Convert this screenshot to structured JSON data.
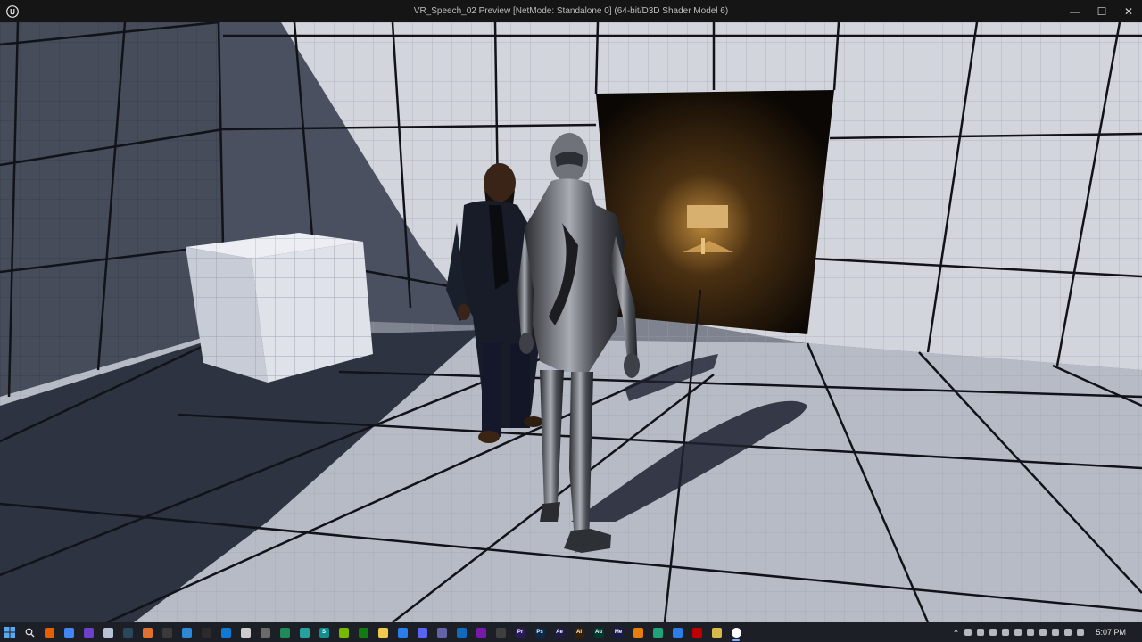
{
  "window": {
    "title": "VR_Speech_02 Preview [NetMode: Standalone 0]  (64-bit/D3D Shader Model 6)",
    "app_logo": "unreal-engine-icon",
    "controls": {
      "minimize": "—",
      "maximize": "☐",
      "close": "✕"
    }
  },
  "taskbar": {
    "start_icon": "windows-start-icon",
    "apps": [
      {
        "name": "search-icon",
        "label": "",
        "color": "#1c1f26"
      },
      {
        "name": "firefox-icon",
        "label": "",
        "color": "#e66000"
      },
      {
        "name": "chrome-icon",
        "label": "",
        "color": "#4285f4"
      },
      {
        "name": "github-desktop-icon",
        "label": "",
        "color": "#6e40c9"
      },
      {
        "name": "cloud-app-icon",
        "label": "",
        "color": "#b9c3d6"
      },
      {
        "name": "steam-icon",
        "label": "",
        "color": "#2a475e"
      },
      {
        "name": "puzzle-app-icon",
        "label": "",
        "color": "#e2712f"
      },
      {
        "name": "epic-games-icon",
        "label": "",
        "color": "#3a3a3a"
      },
      {
        "name": "monitor-app-icon",
        "label": "",
        "color": "#2e88d8"
      },
      {
        "name": "terminal-icon",
        "label": "",
        "color": "#2b2b2b"
      },
      {
        "name": "vscode-icon",
        "label": "",
        "color": "#0e7ad4"
      },
      {
        "name": "unity-icon",
        "label": "",
        "color": "#cccccc"
      },
      {
        "name": "audio-app-icon",
        "label": "",
        "color": "#6a6a6a"
      },
      {
        "name": "vpn-app-icon",
        "label": "",
        "color": "#1e8a5a"
      },
      {
        "name": "cube-app-icon",
        "label": "",
        "color": "#27a0a0"
      },
      {
        "name": "app-s-icon",
        "label": "S",
        "color": "#0f8f8f"
      },
      {
        "name": "nvidia-icon",
        "label": "",
        "color": "#76b900"
      },
      {
        "name": "xbox-icon",
        "label": "",
        "color": "#107c10"
      },
      {
        "name": "file-explorer-icon",
        "label": "",
        "color": "#f2c94c"
      },
      {
        "name": "photos-icon",
        "label": "",
        "color": "#2b7de9"
      },
      {
        "name": "discord-icon",
        "label": "",
        "color": "#5865f2"
      },
      {
        "name": "teams-icon",
        "label": "",
        "color": "#6264a7"
      },
      {
        "name": "outlook-icon",
        "label": "",
        "color": "#0f6cbd"
      },
      {
        "name": "onenote-icon",
        "label": "",
        "color": "#7719aa"
      },
      {
        "name": "audacity-icon",
        "label": "",
        "color": "#3f3f3f"
      },
      {
        "name": "premiere-pro-icon",
        "label": "Pr",
        "color": "#2b1a5a"
      },
      {
        "name": "photoshop-icon",
        "label": "Ps",
        "color": "#0b2a4a"
      },
      {
        "name": "after-effects-icon",
        "label": "Ae",
        "color": "#1f1a4a"
      },
      {
        "name": "illustrator-icon",
        "label": "Ai",
        "color": "#3a1f00"
      },
      {
        "name": "audition-icon",
        "label": "Au",
        "color": "#00392e"
      },
      {
        "name": "media-encoder-icon",
        "label": "Me",
        "color": "#1a1a4a"
      },
      {
        "name": "blender-icon",
        "label": "",
        "color": "#e87d0d"
      },
      {
        "name": "edge-icon",
        "label": "",
        "color": "#1fa37a"
      },
      {
        "name": "remote-desktop-icon",
        "label": "",
        "color": "#2b7de9"
      },
      {
        "name": "filezilla-icon",
        "label": "",
        "color": "#bf0000"
      },
      {
        "name": "notes-icon",
        "label": "",
        "color": "#d8b94a"
      },
      {
        "name": "unreal-engine-taskbar-icon",
        "label": "",
        "color": "#ffffff"
      }
    ],
    "tray": {
      "overflow": "^",
      "icons": [
        "speaker-icon",
        "network-icon",
        "teams-tray-icon",
        "vpn-tray-icon",
        "onedrive-icon",
        "bluetooth-icon",
        "security-icon",
        "mic-icon",
        "app-tray-icon",
        "notification-icon"
      ],
      "time": "5:07 PM"
    }
  }
}
